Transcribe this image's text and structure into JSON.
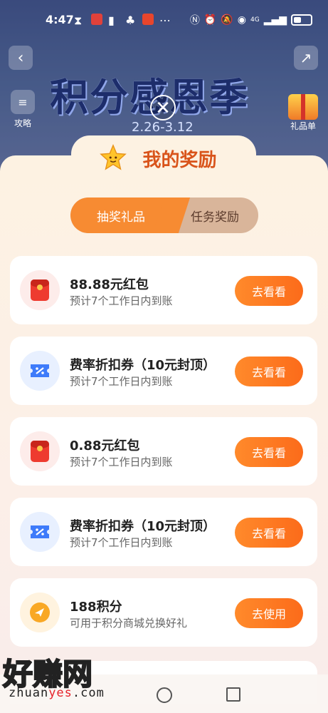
{
  "status_bar": {
    "time": "4:47",
    "net_label": "4G"
  },
  "header": {
    "banner_title": "积分感恩季",
    "banner_date": "2.26-3.12",
    "guide_label": "攻略",
    "gift_list_label": "礼品单"
  },
  "panel": {
    "title": "我的奖励",
    "tabs": [
      {
        "label": "抽奖礼品",
        "active": true
      },
      {
        "label": "任务奖励",
        "active": false
      }
    ],
    "rewards": [
      {
        "icon": "red-packet-icon",
        "title": "88.88元红包",
        "subtitle": "预计7个工作日内到账",
        "button": "去看看"
      },
      {
        "icon": "coupon-icon",
        "title": "费率折扣券（10元封顶）",
        "subtitle": "预计7个工作日内到账",
        "button": "去看看"
      },
      {
        "icon": "red-packet-icon",
        "title": "0.88元红包",
        "subtitle": "预计7个工作日内到账",
        "button": "去看看"
      },
      {
        "icon": "coupon-icon",
        "title": "费率折扣券（10元封顶）",
        "subtitle": "预计7个工作日内到账",
        "button": "去看看"
      },
      {
        "icon": "points-icon",
        "title": "188积分",
        "subtitle": "可用于积分商城兑换好礼",
        "button": "去使用"
      }
    ]
  },
  "watermark": {
    "brand": "好赚网",
    "url_part1": "zhuan",
    "url_highlight": "yes",
    "url_part2": ".com"
  },
  "colors": {
    "accent": "#f78b32",
    "button": "#fc6b1a",
    "title": "#d9541b"
  }
}
